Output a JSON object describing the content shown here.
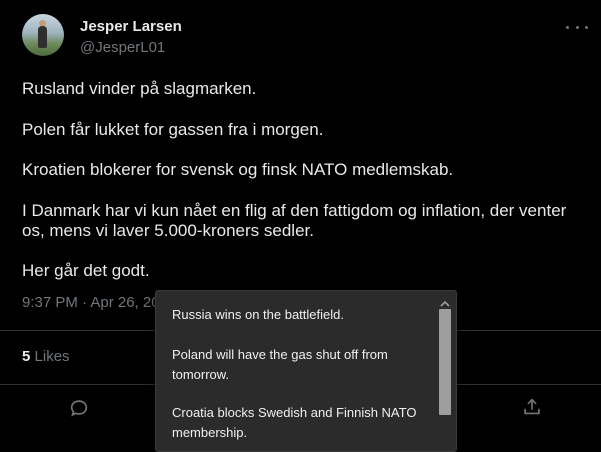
{
  "author": {
    "display_name": "Jesper Larsen",
    "handle": "@JesperL01"
  },
  "tweet": {
    "lines": [
      "Rusland vinder på slagmarken.",
      "Polen får lukket for gassen fra i morgen.",
      "Kroatien blokerer for svensk og finsk NATO medlemskab.",
      "I Danmark har vi kun nået en flig af den fattigdom og inflation, der venter",
      "os, mens vi laver 5.000-kroners sedler.",
      "Her går det godt."
    ],
    "timestamp": "9:37 PM · Apr 26, 20"
  },
  "stats": {
    "likes_count": "5",
    "likes_label": "Likes"
  },
  "translation_popup": {
    "lines": [
      "Russia wins on the battlefield.",
      "Poland will have the gas shut off from",
      "tomorrow.",
      "Croatia blocks Swedish and Finnish NATO",
      "membership."
    ]
  },
  "icons": {
    "more": "more-horizontal-icon",
    "reply": "reply-icon",
    "share": "share-icon",
    "scroll_up": "chevron-up-icon"
  },
  "colors": {
    "background": "#000000",
    "text": "#e7e9ea",
    "muted": "#71767b",
    "divider": "#2f3336",
    "popup_bg": "#2b2b2b"
  }
}
